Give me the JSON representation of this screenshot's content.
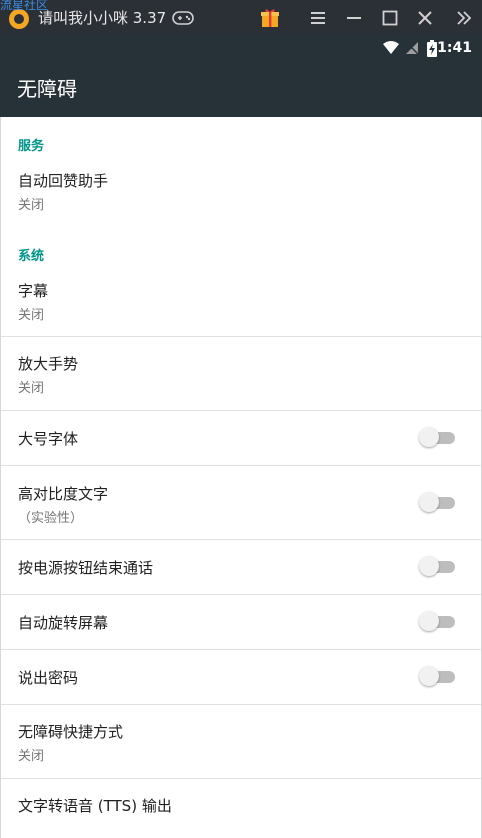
{
  "emulator": {
    "watermark": "流星社区",
    "title": "请叫我小小咪 3.37"
  },
  "status_bar": {
    "time": "1:41"
  },
  "action_bar": {
    "title": "无障碍"
  },
  "sections": {
    "services": {
      "header": "服务",
      "items": [
        {
          "title": "自动回赞助手",
          "summary": "关闭"
        }
      ]
    },
    "system": {
      "header": "系统",
      "items": [
        {
          "title": "字幕",
          "summary": "关闭"
        },
        {
          "title": "放大手势",
          "summary": "关闭"
        },
        {
          "title": "大号字体",
          "switch_on": false
        },
        {
          "title": "高对比度文字",
          "summary": "（实验性）",
          "switch_on": false
        },
        {
          "title": "按电源按钮结束通话",
          "switch_on": false
        },
        {
          "title": "自动旋转屏幕",
          "switch_on": false
        },
        {
          "title": "说出密码",
          "switch_on": false
        },
        {
          "title": "无障碍快捷方式",
          "summary": "关闭"
        },
        {
          "title": "文字转语音 (TTS) 输出"
        }
      ]
    }
  },
  "colors": {
    "app_bar": "#263238",
    "emulator_bar": "#2b2f36",
    "accent": "#009688"
  }
}
